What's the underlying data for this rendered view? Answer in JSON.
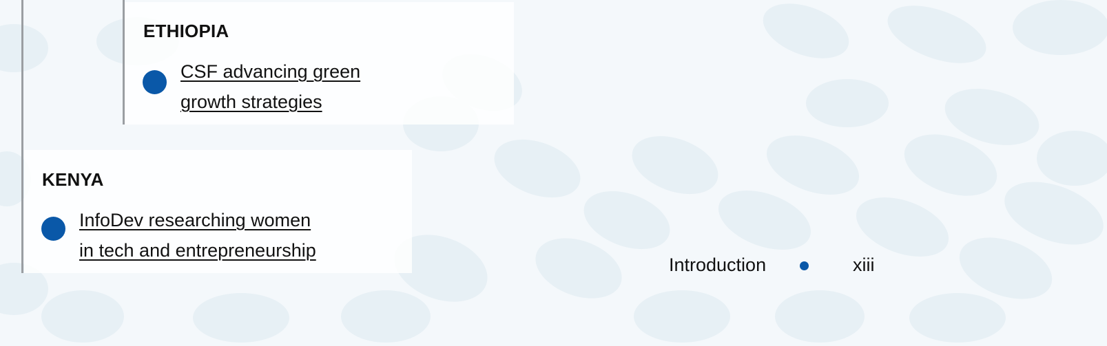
{
  "sections": [
    {
      "country": "ETHIOPIA",
      "link_lines": [
        "CSF advancing green",
        "growth strategies"
      ]
    },
    {
      "country": "KENYA",
      "link_lines": [
        "InfoDev researching women",
        "in tech and entrepreneurship"
      ]
    }
  ],
  "footer": {
    "section": "Introduction",
    "page": "xiii"
  },
  "colors": {
    "accent": "#0a58a8",
    "background": "#f4f8fb",
    "bubble": "#e6f0f5"
  }
}
